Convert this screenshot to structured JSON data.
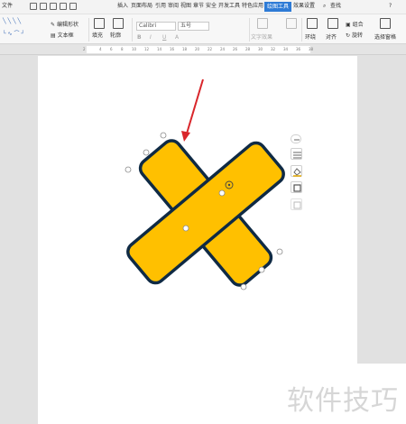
{
  "app": {
    "menu_items": [
      "文件",
      "插入",
      "页面布局",
      "引用",
      "审阅",
      "视图",
      "章节",
      "安全",
      "开发工具",
      "特色应用"
    ],
    "active_tab": "绘图工具",
    "effects_tab": "效果设置",
    "search_label": "查找",
    "help_label": "?"
  },
  "ribbon": {
    "edit_shape": "编辑形状",
    "text_box": "文本框",
    "fill": "填充",
    "outline": "轮廓",
    "font_name": "Calibri",
    "font_size": "五号",
    "text_effect": "文字效果",
    "wrap": "环绕",
    "align": "对齐",
    "group": "组合",
    "rotate": "旋转",
    "select_pane": "选择窗格",
    "bold": "B",
    "italic": "I",
    "underline": "U",
    "font_color": "A"
  },
  "ruler": {
    "ticks": [
      "6",
      "4",
      "2",
      "2",
      "4",
      "6",
      "8",
      "10",
      "12",
      "14",
      "16",
      "18",
      "20",
      "22",
      "24",
      "26",
      "28",
      "30",
      "32",
      "34",
      "36",
      "38",
      "40",
      "44",
      "46"
    ]
  },
  "shape": {
    "fill_color": "#ffc000",
    "outline_color": "#0f2a44",
    "icon": "cross-shape"
  },
  "annotation": {
    "arrow_color": "#d9262b"
  },
  "watermark": {
    "text": "软件技巧"
  }
}
